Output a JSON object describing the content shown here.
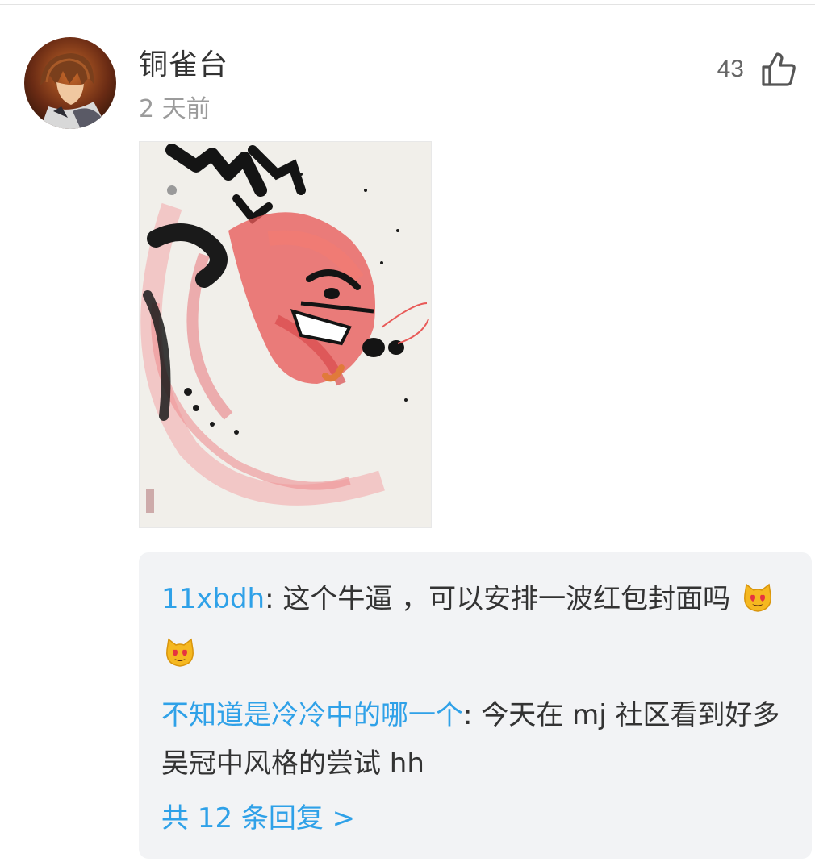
{
  "comment": {
    "username": "铜雀台",
    "timestamp": "2 天前",
    "likes": "43",
    "avatar_icon": "anime-character-avatar",
    "like_icon": "thumbs-up-icon",
    "image_description_icon": "ink-dragon-painting"
  },
  "replies": [
    {
      "author": "11xbdh",
      "separator": ": ",
      "text": "这个牛逼 ，可以安排一波红包封面吗",
      "emojis": [
        "heart-eyes-cat-emoji",
        "heart-eyes-cat-emoji"
      ]
    },
    {
      "author": "不知道是冷冷中的哪一个",
      "separator": ": ",
      "text": "今天在 mj 社区看到好多吴冠中风格的尝试 hh"
    }
  ],
  "more_replies_label": "共 12 条回复 >",
  "colors": {
    "link": "#2fa1e8",
    "text": "#333333",
    "muted": "#9b9b9b",
    "reply_bg": "#f2f3f5"
  }
}
